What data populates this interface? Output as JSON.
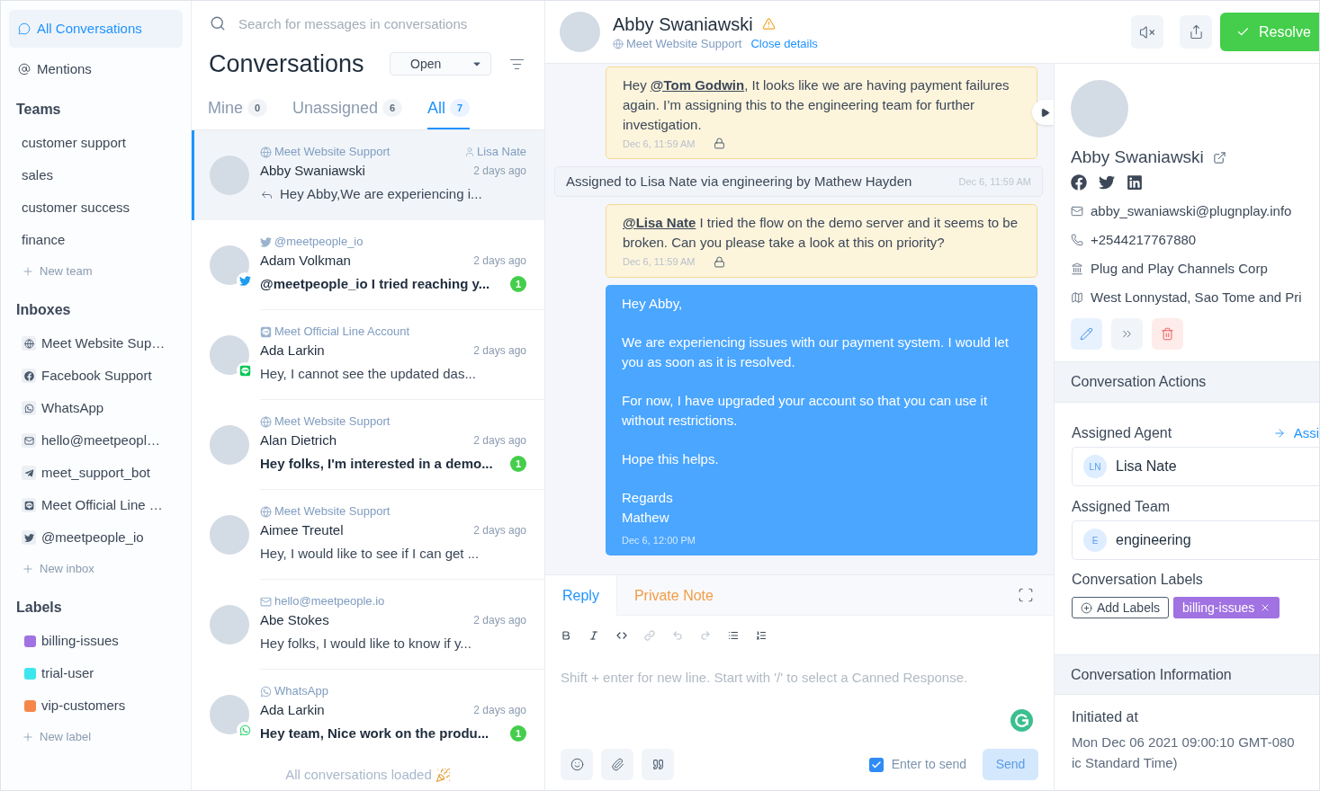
{
  "sidebar": {
    "nav": [
      {
        "label": "All Conversations",
        "selected": true
      },
      {
        "label": "Mentions",
        "selected": false
      }
    ],
    "sections": [
      {
        "title": "Teams",
        "items": [
          {
            "label": "customer support"
          },
          {
            "label": "sales"
          },
          {
            "label": "customer success"
          },
          {
            "label": "finance"
          }
        ],
        "add_label": "New team"
      },
      {
        "title": "Inboxes",
        "items": [
          {
            "label": "Meet Website Sup…",
            "kind": "website"
          },
          {
            "label": "Facebook Support",
            "kind": "facebook"
          },
          {
            "label": "WhatsApp",
            "kind": "whatsapp"
          },
          {
            "label": "hello@meetpeopl…",
            "kind": "email"
          },
          {
            "label": "meet_support_bot",
            "kind": "telegram"
          },
          {
            "label": "Meet Official Line …",
            "kind": "line"
          },
          {
            "label": "@meetpeople_io",
            "kind": "twitter"
          }
        ],
        "add_label": "New inbox"
      },
      {
        "title": "Labels",
        "items": [
          {
            "label": "billing-issues",
            "color": "#a072e2"
          },
          {
            "label": "trial-user",
            "color": "#3de6ee"
          },
          {
            "label": "vip-customers",
            "color": "#f6874b"
          }
        ],
        "add_label": "New label"
      }
    ]
  },
  "conversation_list": {
    "search": {
      "placeholder": "Search for messages in conversations"
    },
    "title": "Conversations",
    "status_filter": "Open",
    "tabs": [
      {
        "label": "Mine",
        "count": "0",
        "selected": false
      },
      {
        "label": "Unassigned",
        "count": "6",
        "selected": false
      },
      {
        "label": "All",
        "count": "7",
        "selected": true
      }
    ],
    "conversations": [
      {
        "kind": "website",
        "inbox": "Meet Website Support",
        "assignee": "Lisa Nate",
        "name": "Abby Swaniawski",
        "time": "2 days ago",
        "message": "Hey Abby,We are experiencing i...",
        "outgoing": true,
        "unread": false,
        "selected": true
      },
      {
        "kind": "twitter",
        "inbox": "@meetpeople_io",
        "name": "Adam Volkman",
        "time": "2 days ago",
        "message": "@meetpeople_io I tried reaching y...",
        "outgoing": false,
        "unread": true,
        "unread_count": "1",
        "selected": false
      },
      {
        "kind": "line",
        "inbox": "Meet Official Line Account",
        "name": "Ada Larkin",
        "time": "2 days ago",
        "message": "Hey, I cannot see the updated das...",
        "outgoing": false,
        "unread": false,
        "selected": false
      },
      {
        "kind": "website",
        "inbox": "Meet Website Support",
        "name": "Alan Dietrich",
        "time": "2 days ago",
        "message": "Hey folks, I'm interested in a demo...",
        "outgoing": false,
        "unread": true,
        "unread_count": "1",
        "selected": false
      },
      {
        "kind": "website",
        "inbox": "Meet Website Support",
        "name": "Aimee Treutel",
        "time": "2 days ago",
        "message": "Hey, I would like to see if I can get ...",
        "outgoing": false,
        "unread": false,
        "selected": false
      },
      {
        "kind": "email",
        "inbox": "hello@meetpeople.io",
        "name": "Abe Stokes",
        "time": "2 days ago",
        "message": "Hey folks, I would like to know if y...",
        "outgoing": false,
        "unread": false,
        "selected": false
      },
      {
        "kind": "whatsapp",
        "inbox": "WhatsApp",
        "name": "Ada Larkin",
        "time": "2 days ago",
        "message": "Hey team, Nice work on the produ...",
        "outgoing": false,
        "unread": true,
        "unread_count": "1",
        "selected": false
      }
    ],
    "footer": "All conversations loaded"
  },
  "conversation": {
    "header": {
      "name": "Abby Swaniawski",
      "inbox": {
        "kind": "website",
        "label": "Meet Website Support"
      },
      "link": "Close details",
      "resolve": "Resolve"
    },
    "messages": [
      {
        "kind": "private_note",
        "text": "Hey **@Tom Godwin**, It looks like we are having payment failures again. I’m assigning this to the engineering team for further investigation.",
        "time": "Dec 6, 11:59 AM"
      },
      {
        "kind": "activity",
        "text": "Assigned to Lisa Nate via engineering by Mathew Hayden",
        "time": "Dec 6, 11:59 AM"
      },
      {
        "kind": "private_note",
        "text": "**@Lisa Nate** I tried the flow on the demo server and it seems to be broken. Can you please take a look at this on priority?",
        "time": "Dec 6, 11:59 AM"
      },
      {
        "kind": "outgoing",
        "paragraphs": [
          "Hey Abby,",
          "We are experiencing issues with our payment system. I would let you as soon as it is resolved.",
          "For now, I have upgraded your account so that you can use it without restrictions.",
          "Hope this helps.",
          "Regards\nMathew"
        ],
        "time": "Dec 6, 12:00 PM"
      }
    ],
    "reply_box": {
      "tabs": [
        {
          "label": "Reply",
          "kind": "reply",
          "selected": true
        },
        {
          "label": "Private Note",
          "kind": "note",
          "selected": false
        }
      ],
      "toolbar": [
        {
          "kind": "bold",
          "disabled": false
        },
        {
          "kind": "italic",
          "disabled": false
        },
        {
          "kind": "code",
          "disabled": false
        },
        {
          "kind": "link",
          "disabled": true
        },
        {
          "kind": "undo",
          "disabled": true
        },
        {
          "kind": "redo",
          "disabled": true
        },
        {
          "kind": "bullet_list",
          "disabled": false
        },
        {
          "kind": "ordered_list",
          "disabled": false
        }
      ],
      "placeholder": "Shift + enter for new line. Start with '/' to select a Canned Response.",
      "enter_to_send": {
        "label": "Enter to send",
        "checked": true
      },
      "send": {
        "label": "Send",
        "disabled": true
      }
    }
  },
  "contact_panel": {
    "name": "Abby Swaniawski",
    "details": [
      {
        "kind": "email",
        "text": "abby_swaniawski@plugnplay.info"
      },
      {
        "kind": "phone",
        "text": "+2544217767880"
      },
      {
        "kind": "company",
        "text": "Plug and Play Channels Corp"
      },
      {
        "kind": "location",
        "text": "West Lonnystad, Sao Tome and Pri"
      }
    ],
    "actions_section": {
      "title": "Conversation Actions",
      "agent": {
        "label": "Assigned Agent",
        "link": "Assi",
        "initials": "LN",
        "value": "Lisa Nate"
      },
      "team": {
        "label": "Assigned Team",
        "initials": "E",
        "value": "engineering"
      },
      "labels_title": "Conversation Labels",
      "add_labels": "Add Labels",
      "labels": [
        {
          "name": "billing-issues",
          "color": "#a072e2"
        }
      ]
    },
    "info_section": {
      "title": "Conversation Information",
      "items": [
        {
          "label": "Initiated at",
          "value_lines": [
            "Mon Dec 06 2021 09:00:10 GMT-080",
            "ic Standard Time)"
          ]
        }
      ]
    }
  }
}
